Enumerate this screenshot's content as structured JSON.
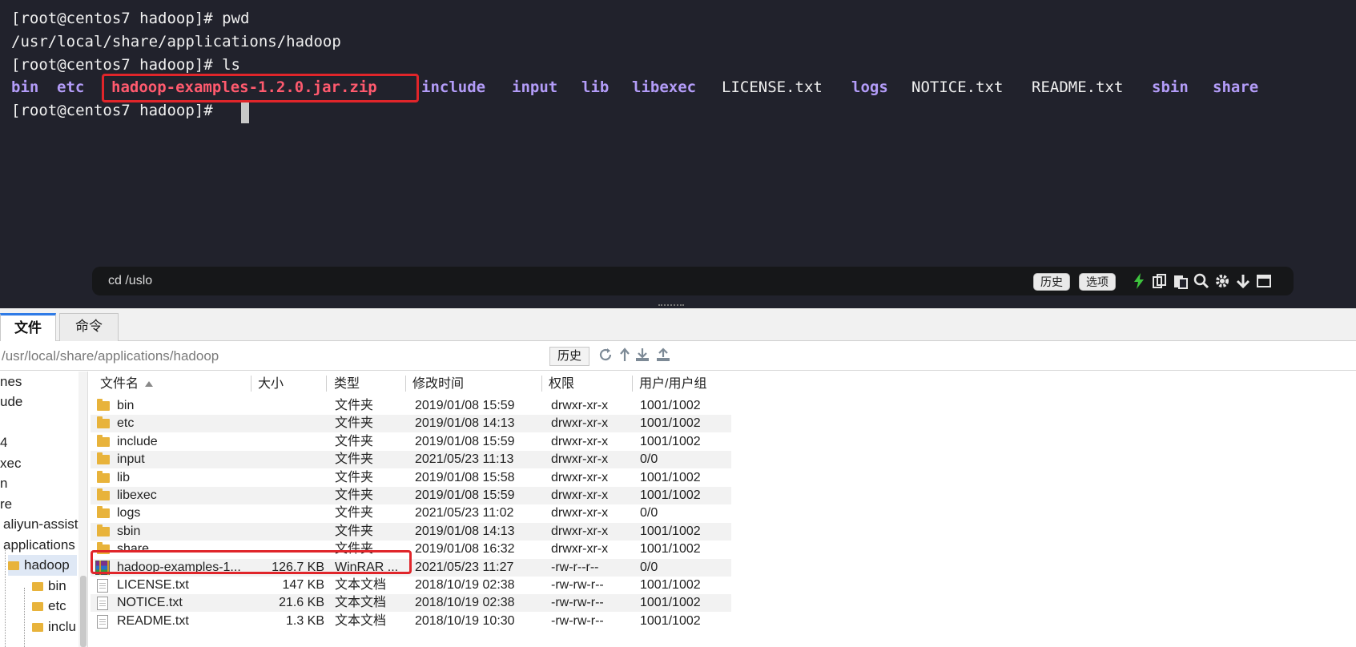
{
  "terminal": {
    "prompt": "[root@centos7 hadoop]# ",
    "cmd1": "pwd",
    "pwd_output": "/usr/local/share/applications/hadoop",
    "cmd2": "ls",
    "ls_output": [
      {
        "name": "bin",
        "kind": "dir"
      },
      {
        "name": "etc",
        "kind": "dir"
      },
      {
        "name": "hadoop-examples-1.2.0.jar.zip",
        "kind": "zip"
      },
      {
        "name": "include",
        "kind": "dir"
      },
      {
        "name": "input",
        "kind": "dir"
      },
      {
        "name": "lib",
        "kind": "dir"
      },
      {
        "name": "libexec",
        "kind": "dir"
      },
      {
        "name": "LICENSE.txt",
        "kind": "file"
      },
      {
        "name": "logs",
        "kind": "dir"
      },
      {
        "name": "NOTICE.txt",
        "kind": "file"
      },
      {
        "name": "README.txt",
        "kind": "file"
      },
      {
        "name": "sbin",
        "kind": "dir"
      },
      {
        "name": "share",
        "kind": "dir"
      }
    ],
    "colors": {
      "background": "#21222c",
      "directory": "#b39cf8",
      "archive": "#ff5a6e",
      "highlight": "#e0252a"
    }
  },
  "command_bar": {
    "input_text": "cd /uslo",
    "history_label": "历史",
    "options_label": "选项",
    "icons": [
      "lightning-icon",
      "copy-icon",
      "paste-icon",
      "search-icon",
      "gear-icon",
      "download-icon",
      "window-icon"
    ]
  },
  "file_manager": {
    "tabs": [
      "文件",
      "命令"
    ],
    "path": "/usr/local/share/applications/hadoop",
    "history_button": "历史",
    "path_icons": [
      "refresh-icon",
      "up-icon",
      "download-icon",
      "upload-icon"
    ],
    "tree": [
      {
        "label": "nes"
      },
      {
        "label": "ude"
      },
      {
        "label": "4"
      },
      {
        "label": "xec"
      },
      {
        "label": "n"
      },
      {
        "label": "re"
      },
      {
        "label": "aliyun-assist"
      },
      {
        "label": "applications"
      },
      {
        "label": "hadoop"
      },
      {
        "label": "bin"
      },
      {
        "label": "etc"
      },
      {
        "label": "inclu"
      }
    ],
    "columns": [
      "文件名",
      "大小",
      "类型",
      "修改时间",
      "权限",
      "用户/用户组"
    ],
    "rows": [
      {
        "name": "bin",
        "size": "",
        "type": "文件夹",
        "modified": "2019/01/08 15:59",
        "perm": "drwxr-xr-x",
        "owner": "1001/1002",
        "icon": "folder"
      },
      {
        "name": "etc",
        "size": "",
        "type": "文件夹",
        "modified": "2019/01/08 14:13",
        "perm": "drwxr-xr-x",
        "owner": "1001/1002",
        "icon": "folder"
      },
      {
        "name": "include",
        "size": "",
        "type": "文件夹",
        "modified": "2019/01/08 15:59",
        "perm": "drwxr-xr-x",
        "owner": "1001/1002",
        "icon": "folder"
      },
      {
        "name": "input",
        "size": "",
        "type": "文件夹",
        "modified": "2021/05/23 11:13",
        "perm": "drwxr-xr-x",
        "owner": "0/0",
        "icon": "folder"
      },
      {
        "name": "lib",
        "size": "",
        "type": "文件夹",
        "modified": "2019/01/08 15:58",
        "perm": "drwxr-xr-x",
        "owner": "1001/1002",
        "icon": "folder"
      },
      {
        "name": "libexec",
        "size": "",
        "type": "文件夹",
        "modified": "2019/01/08 15:59",
        "perm": "drwxr-xr-x",
        "owner": "1001/1002",
        "icon": "folder"
      },
      {
        "name": "logs",
        "size": "",
        "type": "文件夹",
        "modified": "2021/05/23 11:02",
        "perm": "drwxr-xr-x",
        "owner": "0/0",
        "icon": "folder"
      },
      {
        "name": "sbin",
        "size": "",
        "type": "文件夹",
        "modified": "2019/01/08 14:13",
        "perm": "drwxr-xr-x",
        "owner": "1001/1002",
        "icon": "folder"
      },
      {
        "name": "share",
        "size": "",
        "type": "文件夹",
        "modified": "2019/01/08 16:32",
        "perm": "drwxr-xr-x",
        "owner": "1001/1002",
        "icon": "folder"
      },
      {
        "name": "hadoop-examples-1...",
        "size": "126.7 KB",
        "type": "WinRAR ...",
        "modified": "2021/05/23 11:27",
        "perm": "-rw-r--r--",
        "owner": "0/0",
        "icon": "rar"
      },
      {
        "name": "LICENSE.txt",
        "size": "147 KB",
        "type": "文本文档",
        "modified": "2018/10/19 02:38",
        "perm": "-rw-rw-r--",
        "owner": "1001/1002",
        "icon": "doc"
      },
      {
        "name": "NOTICE.txt",
        "size": "21.6 KB",
        "type": "文本文档",
        "modified": "2018/10/19 02:38",
        "perm": "-rw-rw-r--",
        "owner": "1001/1002",
        "icon": "doc"
      },
      {
        "name": "README.txt",
        "size": "1.3 KB",
        "type": "文本文档",
        "modified": "2018/10/19 10:30",
        "perm": "-rw-rw-r--",
        "owner": "1001/1002",
        "icon": "doc"
      }
    ]
  }
}
